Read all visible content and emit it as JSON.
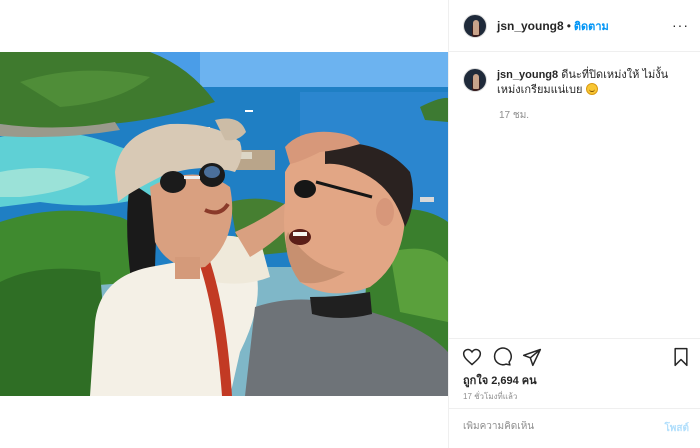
{
  "post": {
    "username": "jsn_young8",
    "follow_label": "ติดตาม",
    "separator": "•",
    "more_label": "···",
    "caption_text": "ดีนะที่ปิดเหม่งให้ ไม่งั้นเหม่งเกรียมแน่เบย",
    "caption_age": "17 ชม.",
    "likes_text": "ถูกใจ 2,694 คน",
    "timestamp": "17 ชั่วโมงที่แล้ว",
    "comment_placeholder": "เพิ่มความคิดเห็น",
    "post_button_label": "โพสต์"
  },
  "icons": {
    "like": "heart-icon",
    "comment": "comment-icon",
    "share": "share-icon",
    "save": "bookmark-icon",
    "emoji": "grimace-emoji-icon"
  },
  "colors": {
    "link_blue": "#0095f6",
    "post_disabled": "#b2dffc",
    "muted": "#8e8e8e",
    "border": "#efefef"
  }
}
